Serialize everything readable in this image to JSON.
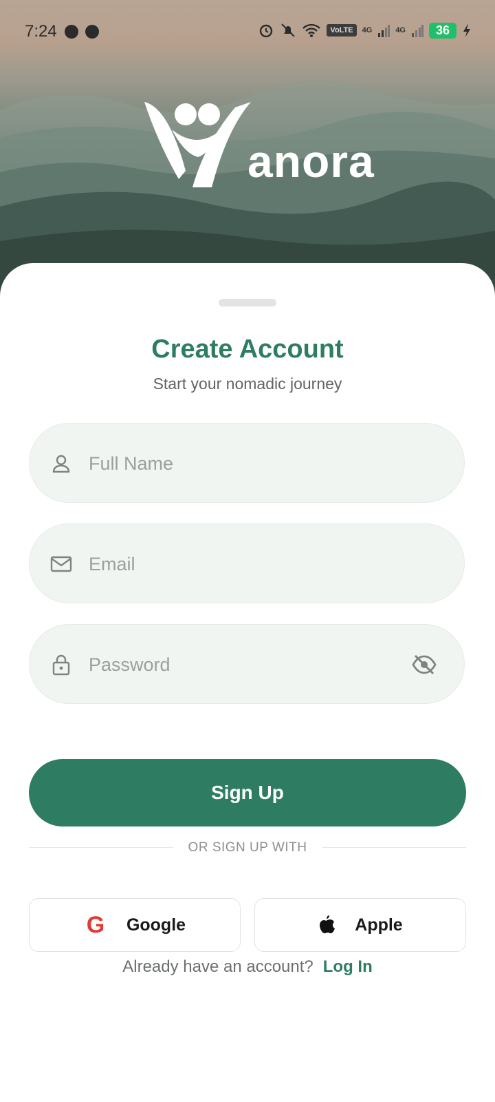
{
  "status_bar": {
    "time": "7:24",
    "volte": "VoLTE",
    "net1": "4G",
    "net2": "4G",
    "battery": "36"
  },
  "brand": {
    "name": "anora"
  },
  "signup": {
    "title": "Create Account",
    "subtitle": "Start your nomadic journey",
    "fields": {
      "name_placeholder": "Full Name",
      "email_placeholder": "Email",
      "password_placeholder": "Password"
    },
    "submit_label": "Sign Up",
    "divider_text": "OR SIGN UP WITH",
    "google_label": "Google",
    "apple_label": "Apple",
    "footer_text": "Already have an account?",
    "login_link": "Log In"
  },
  "colors": {
    "accent": "#2e7d62",
    "field_bg": "#f1f5f2",
    "google_red": "#e53935",
    "battery_green": "#1fc069"
  },
  "icons": {
    "name_field": "person-icon",
    "email_field": "mail-icon",
    "password_field": "lock-icon",
    "password_toggle": "eye-off-icon",
    "google": "google-icon",
    "apple": "apple-icon"
  }
}
